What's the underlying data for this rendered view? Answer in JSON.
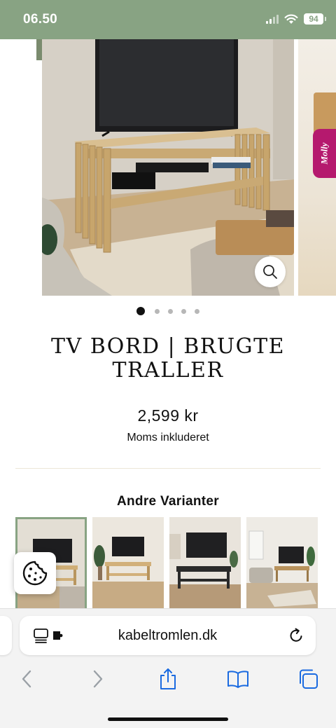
{
  "status_bar": {
    "time": "06.50",
    "battery": "94",
    "background_color": "#88a383"
  },
  "gallery": {
    "slide_count": 5,
    "active_index": 0,
    "zoom_icon": "magnifier-icon"
  },
  "molly_tab": {
    "label": "Molly",
    "color": "#b5196e"
  },
  "product": {
    "title": "TV BORD | BRUGTE TRALLER",
    "price": "2,599 kr",
    "vat_note": "Moms inkluderet"
  },
  "variants": {
    "heading": "Andre Varianter",
    "selected_index": 0,
    "count": 4
  },
  "cookie_button": {
    "icon": "cookie-icon"
  },
  "browser": {
    "url": "kabeltromlen.dk",
    "toolbar_icons": [
      "back-icon",
      "forward-icon",
      "share-icon",
      "bookmarks-icon",
      "tabs-icon"
    ],
    "accent_color": "#1a6ae0"
  }
}
